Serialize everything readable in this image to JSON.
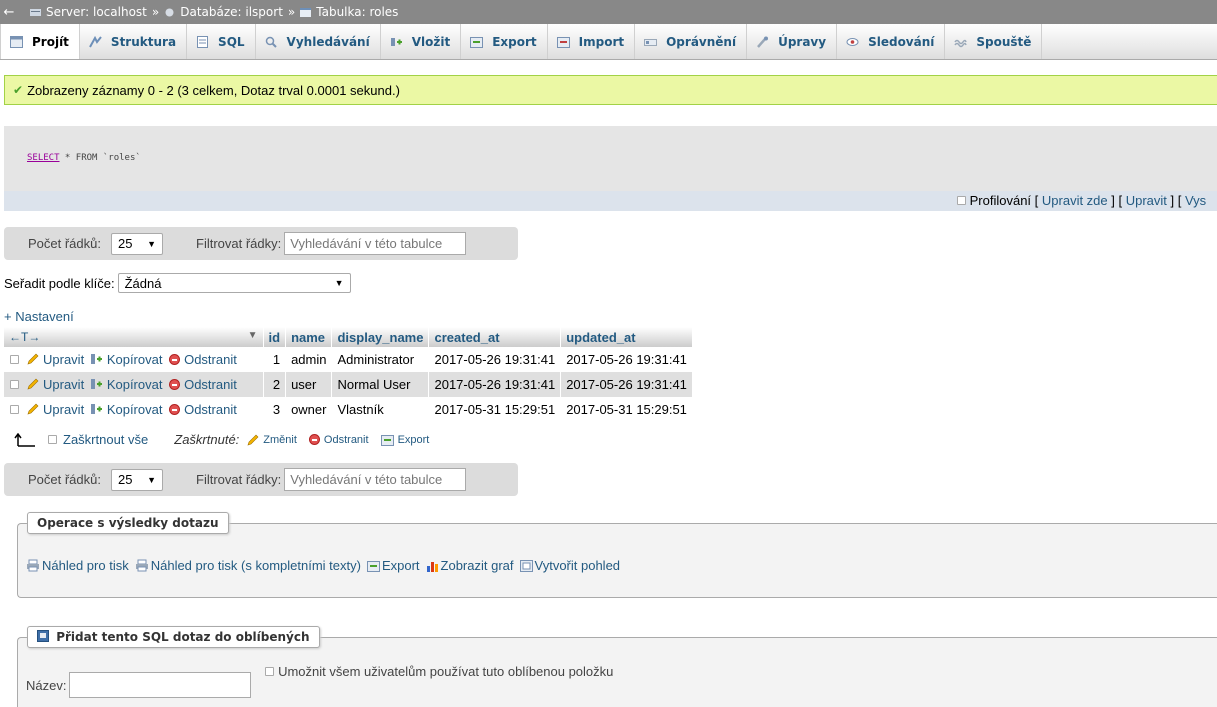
{
  "breadcrumb": {
    "back": "←",
    "server": "Server: localhost",
    "database": "Databáze: ilsport",
    "table": "Tabulka: roles",
    "sep": "»"
  },
  "tabs": [
    {
      "label": "Projít",
      "icon": "browse-icon"
    },
    {
      "label": "Struktura",
      "icon": "structure-icon"
    },
    {
      "label": "SQL",
      "icon": "sql-icon"
    },
    {
      "label": "Vyhledávání",
      "icon": "search-icon"
    },
    {
      "label": "Vložit",
      "icon": "insert-icon"
    },
    {
      "label": "Export",
      "icon": "export-icon"
    },
    {
      "label": "Import",
      "icon": "import-icon"
    },
    {
      "label": "Oprávnění",
      "icon": "privileges-icon"
    },
    {
      "label": "Úpravy",
      "icon": "operations-icon"
    },
    {
      "label": "Sledování",
      "icon": "tracking-icon"
    },
    {
      "label": "Spouště",
      "icon": "triggers-icon"
    }
  ],
  "success_message": "Zobrazeny záznamy 0 - 2 (3 celkem, Dotaz trval 0.0001 sekund.)",
  "sql": {
    "keyword": "SELECT",
    "rest": " * FROM `roles`"
  },
  "sql_tools": {
    "profiling": "Profilování",
    "open1": " [ ",
    "edit_inline": "Upravit zde",
    "mid": " ] [ ",
    "edit": "Upravit",
    "mid2": " ] [ ",
    "explain": "Vys"
  },
  "navigation": {
    "rows_label": "Počet řádků:",
    "rows_value": "25",
    "filter_label": "Filtrovat řádky:",
    "filter_placeholder": "Vyhledávání v této tabulce"
  },
  "sort": {
    "label": "Seřadit podle klíče:",
    "value": "Žádná"
  },
  "settings_link": "+ Nastavení",
  "table": {
    "nav_arrows": "←T→",
    "columns": [
      "id",
      "name",
      "display_name",
      "created_at",
      "updated_at"
    ],
    "actions": {
      "edit": "Upravit",
      "copy": "Kopírovat",
      "delete": "Odstranit"
    },
    "rows": [
      {
        "id": "1",
        "name": "admin",
        "display_name": "Administrator",
        "created_at": "2017-05-26 19:31:41",
        "updated_at": "2017-05-26 19:31:41"
      },
      {
        "id": "2",
        "name": "user",
        "display_name": "Normal User",
        "created_at": "2017-05-26 19:31:41",
        "updated_at": "2017-05-26 19:31:41"
      },
      {
        "id": "3",
        "name": "owner",
        "display_name": "Vlastník",
        "created_at": "2017-05-31 15:29:51",
        "updated_at": "2017-05-31 15:29:51"
      }
    ]
  },
  "bulk": {
    "select_all": "Zaškrtnout vše",
    "checked_label": "Zaškrtnuté:",
    "change": "Změnit",
    "delete": "Odstranit",
    "export": "Export"
  },
  "query_ops": {
    "legend": "Operace s výsledky dotazu",
    "print": "Náhled pro tisk",
    "print_full": "Náhled pro tisk (s kompletními texty)",
    "export": "Export",
    "chart": "Zobrazit graf",
    "view": "Vytvořit pohled"
  },
  "bookmark": {
    "legend": "Přidat tento SQL dotaz do oblíbených",
    "name_label": "Název:",
    "share_label": "Umožnit všem uživatelům používat tuto oblíbenou položku"
  },
  "colors": {
    "link": "#235a81",
    "success_bg": "#ebf8a4",
    "topbar": "#888888"
  }
}
